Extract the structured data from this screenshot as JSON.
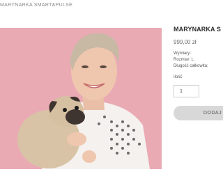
{
  "breadcrumb": "MARYNARKA SMART&PULSE",
  "product": {
    "title": "MARYNARKA S",
    "price": "999,00 zł",
    "attributes": {
      "heading": "Wymiary:",
      "size": "Rozmiar: L",
      "length": "Długość całkowita:"
    },
    "quantity_label": "Ilość",
    "quantity_value": "1",
    "add_to_cart_label": "DODAJ D"
  },
  "image": {
    "subject": "product-photo",
    "background_color": "#eaaab4"
  }
}
